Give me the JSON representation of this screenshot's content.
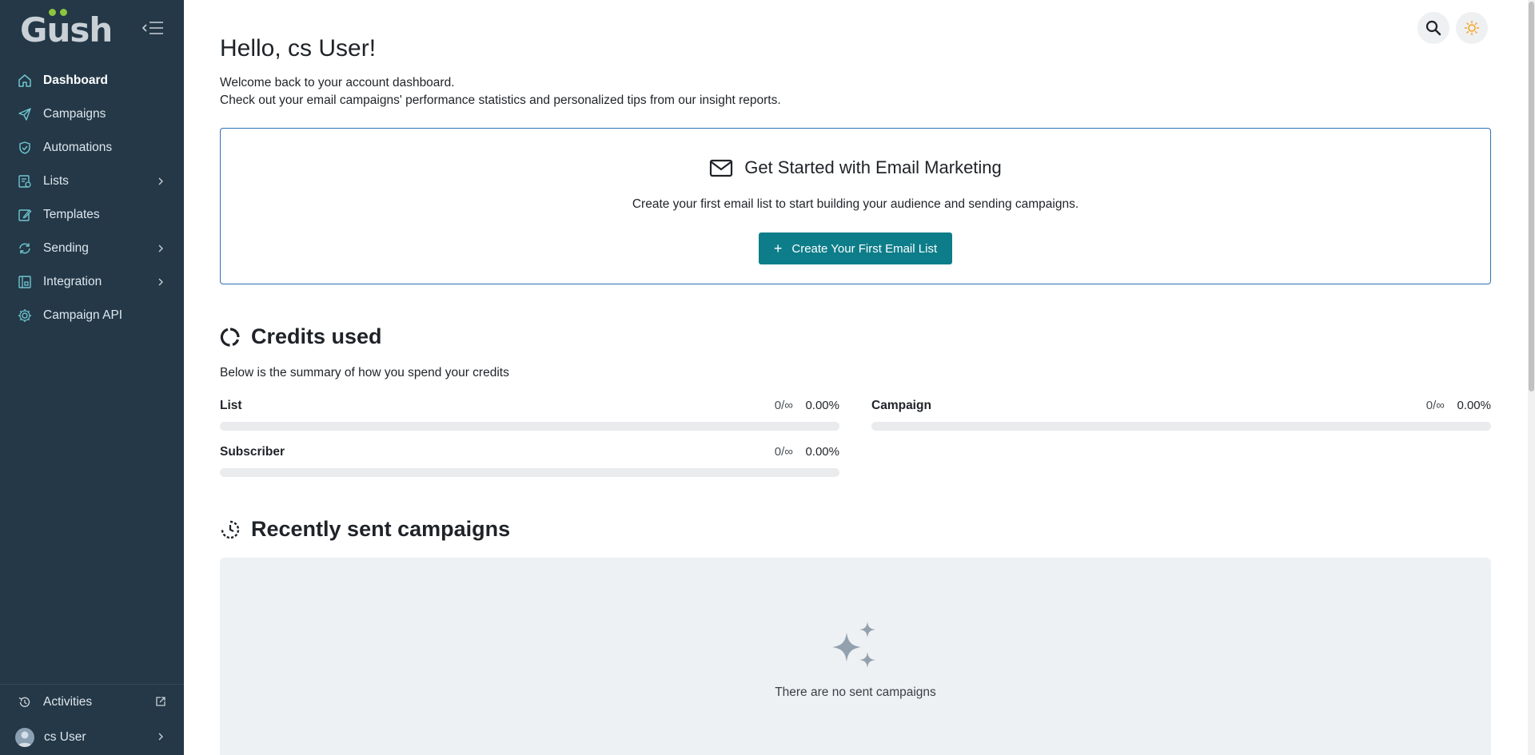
{
  "app": {
    "logo_text_g": "G",
    "logo_text_u": "u",
    "logo_text_sh": "sh"
  },
  "sidebar": {
    "items": [
      {
        "label": "Dashboard",
        "icon": "home-icon",
        "active": true,
        "has_submenu": false
      },
      {
        "label": "Campaigns",
        "icon": "paper-plane-icon",
        "active": false,
        "has_submenu": false
      },
      {
        "label": "Automations",
        "icon": "shield-check-icon",
        "active": false,
        "has_submenu": false
      },
      {
        "label": "Lists",
        "icon": "list-icon",
        "active": false,
        "has_submenu": true
      },
      {
        "label": "Templates",
        "icon": "edit-icon",
        "active": false,
        "has_submenu": false
      },
      {
        "label": "Sending",
        "icon": "sync-icon",
        "active": false,
        "has_submenu": true
      },
      {
        "label": "Integration",
        "icon": "integration-icon",
        "active": false,
        "has_submenu": true
      },
      {
        "label": "Campaign API",
        "icon": "api-gear-icon",
        "active": false,
        "has_submenu": false
      }
    ],
    "bottom": {
      "activities_label": "Activities",
      "user_label": "cs User"
    }
  },
  "header": {
    "search_icon": "search-icon",
    "theme_icon": "sun-icon"
  },
  "main": {
    "greeting": "Hello, cs User!",
    "welcome_line1": "Welcome back to your account dashboard.",
    "welcome_line2": "Check out your email campaigns' performance statistics and personalized tips from our insight reports.",
    "get_started": {
      "title": "Get Started with Email Marketing",
      "description": "Create your first email list to start building your audience and sending campaigns.",
      "button_label": "Create Your First Email List",
      "button_plus": "+"
    },
    "credits": {
      "title": "Credits used",
      "description": "Below is the summary of how you spend your credits",
      "items": [
        {
          "label": "List",
          "count": "0/∞",
          "percent": "0.00%",
          "fill": 0
        },
        {
          "label": "Campaign",
          "count": "0/∞",
          "percent": "0.00%",
          "fill": 0
        },
        {
          "label": "Subscriber",
          "count": "0/∞",
          "percent": "0.00%",
          "fill": 0
        }
      ]
    },
    "recent": {
      "title": "Recently sent campaigns",
      "empty_text": "There are no sent campaigns"
    }
  },
  "colors": {
    "sidebar_bg": "#243847",
    "accent": "#0e7d8a",
    "card_border": "#2f6fb5",
    "theme_sun": "#f5a623"
  }
}
